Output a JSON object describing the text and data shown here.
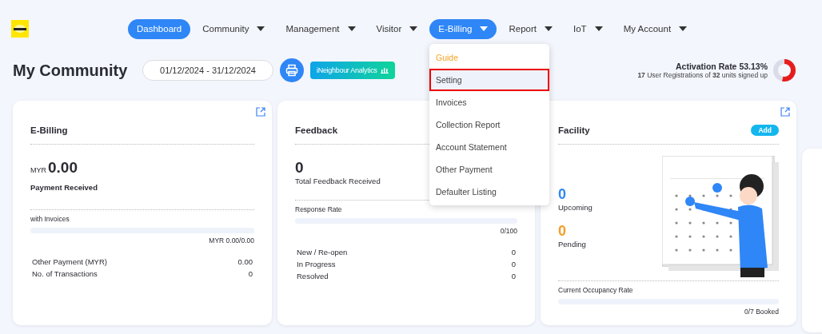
{
  "nav": [
    {
      "label": "Dashboard",
      "kind": "link",
      "selected": true
    },
    {
      "label": "Community",
      "kind": "menu",
      "selected": false
    },
    {
      "label": "Management",
      "kind": "menu",
      "selected": false
    },
    {
      "label": "Visitor",
      "kind": "menu",
      "selected": false
    },
    {
      "label": "E-Billing",
      "kind": "menu",
      "selected": true
    },
    {
      "label": "Report",
      "kind": "menu",
      "selected": false
    },
    {
      "label": "IoT",
      "kind": "menu",
      "selected": false
    },
    {
      "label": "My Account",
      "kind": "menu",
      "selected": false
    }
  ],
  "dropdown": {
    "items": [
      {
        "label": "Guide",
        "kind": "guide",
        "selected": false
      },
      {
        "label": "Setting",
        "kind": "item",
        "selected": true
      },
      {
        "label": "Invoices",
        "kind": "item",
        "selected": false
      },
      {
        "label": "Collection Report",
        "kind": "item",
        "selected": false
      },
      {
        "label": "Account Statement",
        "kind": "item",
        "selected": false
      },
      {
        "label": "Other Payment",
        "kind": "item",
        "selected": false
      },
      {
        "label": "Defaulter Listing",
        "kind": "item",
        "selected": false
      }
    ]
  },
  "page_title": "My Community",
  "date_range": "01/12/2024 - 31/12/2024",
  "analytics_button": "iNeighbour Analytics",
  "activation": {
    "title": "Activation Rate 53.13%",
    "registered": "17",
    "text1": "User Registrations of",
    "units": "32",
    "text2": "units signed up",
    "level": 0.5313
  },
  "ebilling": {
    "title": "E-Billing",
    "currency": "MYR",
    "amount": "0.00",
    "amount_label": "Payment Received",
    "bar_label": "with Invoices",
    "level": 0,
    "bar_reading": "MYR 0.00/0.00",
    "rows": [
      {
        "label": "Other Payment (MYR)",
        "value": "0.00"
      },
      {
        "label": "No. of Transactions",
        "value": "0"
      }
    ]
  },
  "feedback": {
    "title": "Feedback",
    "count": "0",
    "count_label": "Total Feedback Received",
    "bar_label": "Response Rate",
    "level": 0,
    "bar_reading": "0/100",
    "rows": [
      {
        "label": "New / Re-open",
        "value": "0"
      },
      {
        "label": "In Progress",
        "value": "0"
      },
      {
        "label": "Resolved",
        "value": "0"
      }
    ]
  },
  "facility": {
    "title": "Facility",
    "add_button": "Add",
    "upcoming": "0",
    "upcoming_label": "Upcoming",
    "pending": "0",
    "pending_label": "Pending",
    "bar_label": "Current Occupancy Rate",
    "level": 0,
    "bar_reading": "0/7 Booked"
  }
}
